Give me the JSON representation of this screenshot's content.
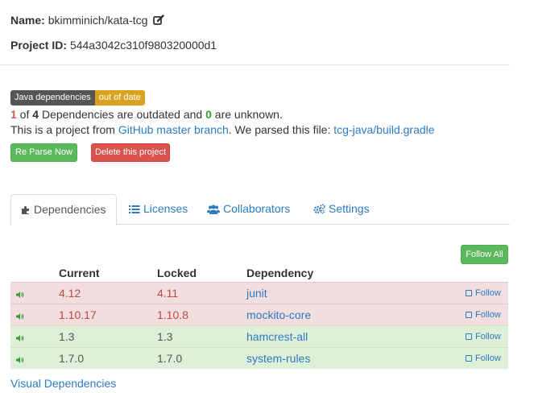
{
  "project": {
    "name_label": "Name:",
    "name_value": "bkimminich/kata-tcg",
    "id_label": "Project ID:",
    "id_value": "544a3042c310f980320000d1"
  },
  "badge": {
    "left": "Java dependencies",
    "right": "out of date",
    "left_color": "#555555",
    "right_color": "#d9a320"
  },
  "summary": {
    "outdated": "1",
    "of": " of ",
    "total": "4",
    "middle": " Dependencies are outdated and ",
    "unknown": "0",
    "end": " are unknown."
  },
  "source": {
    "prefix": "This is a project from ",
    "branch_link": "GitHub master branch",
    "middle": ". We parsed this file: ",
    "file_link": "tcg-java/build.gradle"
  },
  "buttons": {
    "reparse": "Re Parse Now",
    "delete": "Delete this project",
    "follow_all": "Follow All"
  },
  "tabs": [
    {
      "label": "Dependencies",
      "icon": "puzzle-icon",
      "active": true
    },
    {
      "label": "Licenses",
      "icon": "list-icon",
      "active": false
    },
    {
      "label": "Collaborators",
      "icon": "users-icon",
      "active": false
    },
    {
      "label": "Settings",
      "icon": "gears-icon",
      "active": false
    }
  ],
  "table": {
    "headers": [
      "Current",
      "Locked",
      "Dependency"
    ],
    "rows": [
      {
        "current": "4.12",
        "locked": "4.11",
        "dependency": "junit",
        "status": "outdated",
        "follow": "Follow"
      },
      {
        "current": "1.10.17",
        "locked": "1.10.8",
        "dependency": "mockito-core",
        "status": "outdated",
        "follow": "Follow"
      },
      {
        "current": "1.3",
        "locked": "1.3",
        "dependency": "hamcrest-all",
        "status": "up-to-date",
        "follow": "Follow"
      },
      {
        "current": "1.7.0",
        "locked": "1.7.0",
        "dependency": "system-rules",
        "status": "up-to-date",
        "follow": "Follow"
      }
    ]
  },
  "footer": {
    "visual_link": "Visual Dependencies"
  },
  "colors": {
    "link": "#2a7bc0",
    "success": "#5cb85c",
    "danger": "#d9534f",
    "row_outdated": "#f2dede",
    "row_ok": "#dff0d8"
  }
}
